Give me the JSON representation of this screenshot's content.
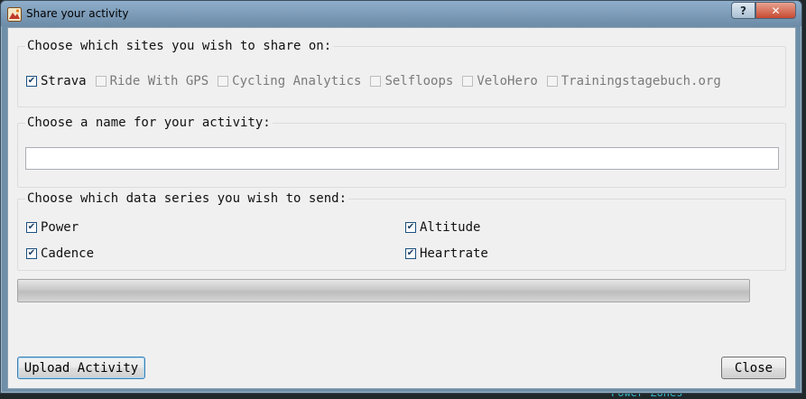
{
  "window": {
    "title": "Share your activity",
    "help_label": "?",
    "close_glyph": "✕"
  },
  "sites_group": {
    "title": "Choose which sites you wish to share on:",
    "sites": [
      {
        "label": "Strava",
        "checked": true,
        "enabled": true
      },
      {
        "label": "Ride With GPS",
        "checked": false,
        "enabled": false
      },
      {
        "label": "Cycling Analytics",
        "checked": false,
        "enabled": false
      },
      {
        "label": "Selfloops",
        "checked": false,
        "enabled": false
      },
      {
        "label": "VeloHero",
        "checked": false,
        "enabled": false
      },
      {
        "label": "Trainingstagebuch.org",
        "checked": false,
        "enabled": false
      }
    ]
  },
  "name_group": {
    "title": "Choose a name for your activity:",
    "value": "",
    "placeholder": ""
  },
  "series_group": {
    "title": "Choose which data series you wish to send:",
    "series": [
      {
        "label": "Power",
        "checked": true
      },
      {
        "label": "Altitude",
        "checked": true
      },
      {
        "label": "Cadence",
        "checked": true
      },
      {
        "label": "Heartrate",
        "checked": true
      }
    ]
  },
  "progress": {
    "value": 0
  },
  "buttons": {
    "upload_label": "Upload Activity",
    "close_label": "Close"
  },
  "background": {
    "partial_text": "Power Zones"
  },
  "colors": {
    "titlebar": "#7c9cb8",
    "client": "#f0f0f0",
    "close_button": "#c74a32",
    "default_button_border": "#3c7fb1"
  }
}
